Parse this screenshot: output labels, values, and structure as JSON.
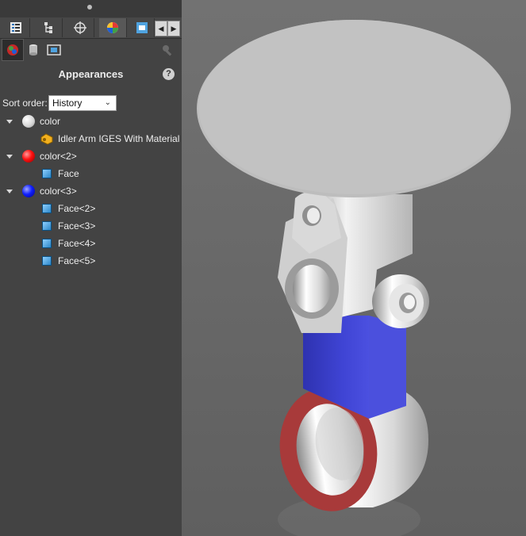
{
  "panel": {
    "title": "Appearances",
    "help": "?",
    "sort_order_label": "Sort order:",
    "sort_order_value": "History"
  },
  "tree": {
    "items": [
      {
        "label": "color",
        "swatch": "white"
      },
      {
        "label": "Idler Arm IGES With Material",
        "icon": "part-icon"
      },
      {
        "label": "color<2>",
        "swatch": "red"
      },
      {
        "label": "Face",
        "icon": "face-icon"
      },
      {
        "label": "color<3>",
        "swatch": "blue"
      },
      {
        "label": "Face<2>",
        "icon": "face-icon"
      },
      {
        "label": "Face<3>",
        "icon": "face-icon"
      },
      {
        "label": "Face<4>",
        "icon": "face-icon"
      },
      {
        "label": "Face<5>",
        "icon": "face-icon"
      }
    ]
  },
  "colors": {
    "panel_bg": "#434343",
    "viewport_bg": "#6b6b6b",
    "red_face": "#b23a3a",
    "blue_face": "#3b3fcf"
  }
}
